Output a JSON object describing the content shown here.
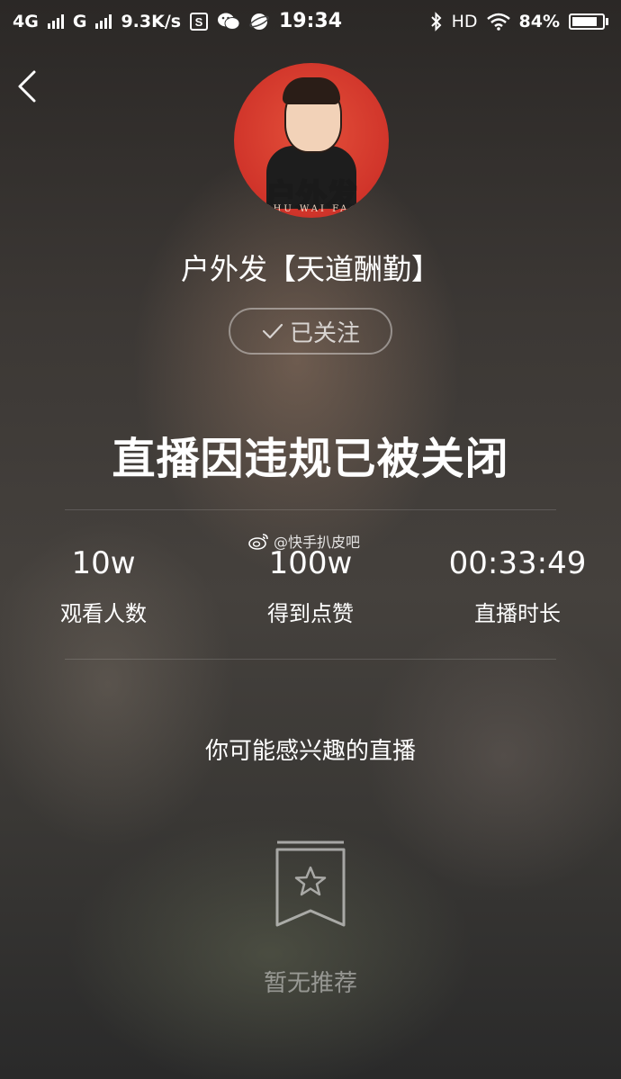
{
  "status_bar": {
    "net1": "4G",
    "net2": "G",
    "speed": "9.3K/s",
    "time": "19:34",
    "hd": "HD",
    "battery": "84%",
    "battery_level": 0.84,
    "icons": [
      "signal-icon",
      "s-app-icon",
      "wechat-icon",
      "planet-app-icon",
      "bluetooth-icon",
      "wifi-icon",
      "battery-icon"
    ]
  },
  "streamer": {
    "avatar_text": "户外发",
    "avatar_subtext": "HU WAI FA",
    "name": "户外发【天道酬勤】",
    "follow_label": "已关注"
  },
  "headline": "直播因违规已被关闭",
  "watermark": "@快手扒皮吧",
  "stats": [
    {
      "value": "10w",
      "label": "观看人数"
    },
    {
      "value": "100w",
      "label": "得到点赞"
    },
    {
      "value": "00:33:49",
      "label": "直播时长"
    }
  ],
  "recommend": {
    "title": "你可能感兴趣的直播",
    "empty_text": "暂无推荐"
  }
}
